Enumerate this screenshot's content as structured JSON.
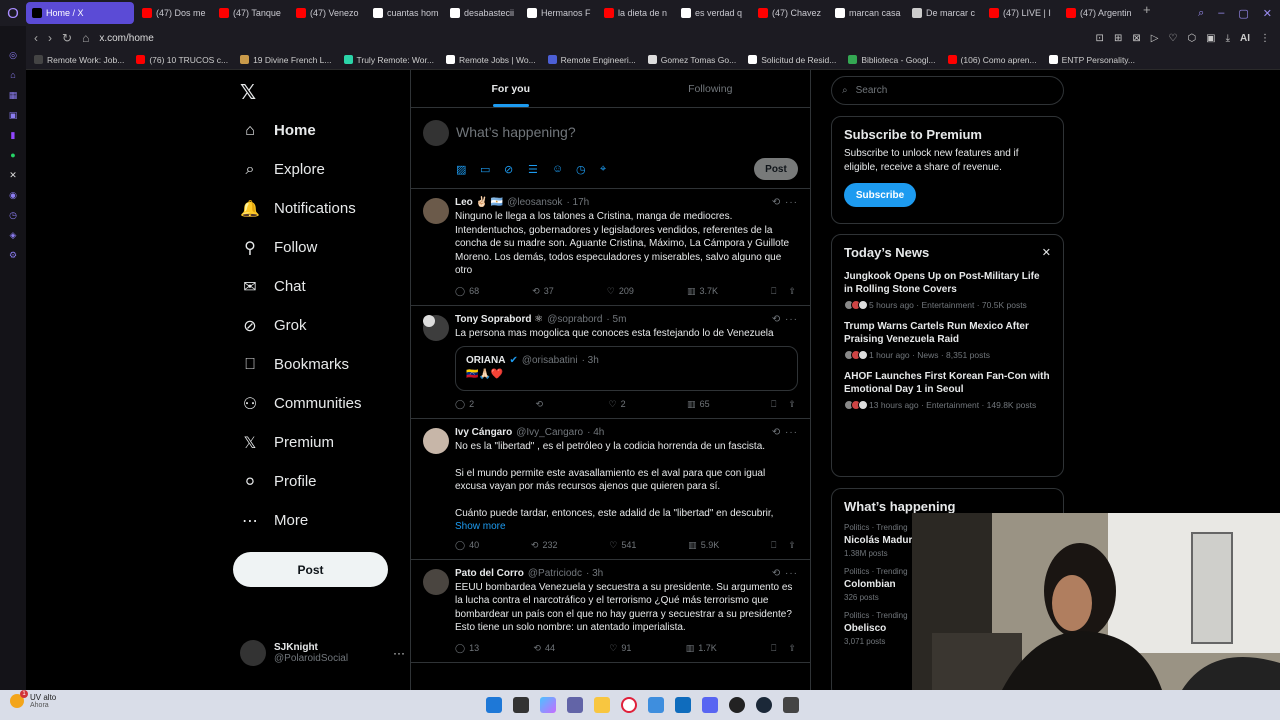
{
  "browser": {
    "tabs": [
      {
        "label": "Home / X",
        "active": true,
        "color": "#000000"
      },
      {
        "label": "(47) Dos me",
        "color": "#ff0000"
      },
      {
        "label": "(47) Tanque",
        "color": "#ff0000"
      },
      {
        "label": "(47) Venezo",
        "color": "#ff0000"
      },
      {
        "label": "cuantas hom",
        "color": "#ffffff"
      },
      {
        "label": "desabastecii",
        "color": "#ffffff"
      },
      {
        "label": "Hermanos F",
        "color": "#ffffff"
      },
      {
        "label": "la dieta de n",
        "color": "#ff0000"
      },
      {
        "label": "es verdad q",
        "color": "#ffffff"
      },
      {
        "label": "(47) Chavez",
        "color": "#ff0000"
      },
      {
        "label": "marcan casa",
        "color": "#ffffff"
      },
      {
        "label": "De marcar c",
        "color": "#cccccc"
      },
      {
        "label": "(47) LIVE | I",
        "color": "#ff0000"
      },
      {
        "label": "(47) Argentin",
        "color": "#ff0000"
      }
    ],
    "url": "x.com/home",
    "ai_label": "AI",
    "bookmarks": [
      {
        "label": "Remote Work: Job...",
        "color": "#444444"
      },
      {
        "label": "(76) 10 TRUCOS c...",
        "color": "#ff0000"
      },
      {
        "label": "19 Divine French L...",
        "color": "#c99a4a"
      },
      {
        "label": "Truly Remote: Wor...",
        "color": "#2bd4a8"
      },
      {
        "label": "Remote Jobs | Wo...",
        "color": "#ffffff"
      },
      {
        "label": "Remote Engineeri...",
        "color": "#4c5fd5"
      },
      {
        "label": "Gomez Tomas Go...",
        "color": "#dddddd"
      },
      {
        "label": "Solicitud de Resid...",
        "color": "#ffffff"
      },
      {
        "label": "Biblioteca - Googl...",
        "color": "#34a853"
      },
      {
        "label": "(106) Como apren...",
        "color": "#ff0000"
      },
      {
        "label": "ENTP Personality...",
        "color": "#ffffff"
      }
    ]
  },
  "nav": {
    "items": [
      {
        "label": "Home",
        "icon": "⌂"
      },
      {
        "label": "Explore",
        "icon": "⌕"
      },
      {
        "label": "Notifications",
        "icon": "🔔"
      },
      {
        "label": "Follow",
        "icon": "⚲"
      },
      {
        "label": "Chat",
        "icon": "✉"
      },
      {
        "label": "Grok",
        "icon": "⊘"
      },
      {
        "label": "Bookmarks",
        "icon": "⎕"
      },
      {
        "label": "Communities",
        "icon": "⚇"
      },
      {
        "label": "Premium",
        "icon": "𝕏"
      },
      {
        "label": "Profile",
        "icon": "⚪"
      },
      {
        "label": "More",
        "icon": "⋯"
      }
    ],
    "post_label": "Post",
    "account": {
      "name": "SJKnight",
      "handle": "@PolaroidSocial"
    }
  },
  "feed": {
    "tabs": [
      "For you",
      "Following"
    ],
    "compose_placeholder": "What’s happening?",
    "post_label": "Post",
    "tweets": [
      {
        "name": "Leo ✌🏻 🇦🇷",
        "handle": "@leosansok",
        "time": "· 17h",
        "text": "Ninguno le llega a los talones a Cristina, manga de mediocres. Intendentuchos, gobernadores y legisladores vendidos, referentes de la concha de su madre son. Aguante Cristina, Máximo, La Cámpora y Guillote Moreno. Los demás, todos especuladores y miserables, salvo alguno que otro",
        "replies": "68",
        "reposts": "37",
        "likes": "209",
        "views": "3.7K"
      },
      {
        "name": "Tony Soprabord ⚛",
        "handle": "@soprabord",
        "time": "· 5m",
        "text": "La persona mas mogolica que conoces esta festejando lo de Venezuela",
        "quote": {
          "name": "ORIANA",
          "handle": "@orisabatini",
          "time": "· 3h",
          "text": "🇻🇪🙏🏻❤️"
        },
        "replies": "2",
        "reposts": "",
        "likes": "2",
        "views": "65"
      },
      {
        "name": "Ivy Cángaro",
        "handle": "@Ivy_Cangaro",
        "time": "· 4h",
        "text": "No es la \"libertad\" , es el petróleo y la codicia horrenda de un fascista.\n\nSi el mundo permite este avasallamiento es el aval para que con igual excusa vayan por más recursos ajenos que quieren para sí.\n\nCuánto puede tardar, entonces, este adalid de la \"libertad\" en descubrir,",
        "show_more": "Show more",
        "replies": "40",
        "reposts": "232",
        "likes": "541",
        "views": "5.9K"
      },
      {
        "name": "Pato del Corro",
        "handle": "@Patriciodc",
        "time": "· 3h",
        "text": "EEUU bombardea Venezuela y secuestra a su presidente. Su argumento es la lucha contra el narcotráfico y el terrorismo ¿Qué más terrorismo que bombardear un país con el que no hay guerra y secuestrar a su presidente?  Esto tiene un solo nombre: un atentado imperialista.",
        "replies": "13",
        "reposts": "44",
        "likes": "91",
        "views": "1.7K"
      }
    ]
  },
  "right": {
    "search_placeholder": "Search",
    "premium": {
      "title": "Subscribe to Premium",
      "text": "Subscribe to unlock new features and if eligible, receive a share of revenue.",
      "button": "Subscribe"
    },
    "news": {
      "title": "Today’s News",
      "items": [
        {
          "title": "Jungkook Opens Up on Post-Military Life in Rolling Stone Covers",
          "meta": "5 hours ago · Entertainment · 70.5K posts"
        },
        {
          "title": "Trump Warns Cartels Run Mexico After Praising Venezuela Raid",
          "meta": "1 hour ago · News · 8,351 posts"
        },
        {
          "title": "AHOF Launches First Korean Fan-Con with Emotional Day 1 in Seoul",
          "meta": "13 hours ago · Entertainment · 149.8K posts"
        }
      ]
    },
    "happening": {
      "title": "What’s happening",
      "trends": [
        {
          "meta": "Politics · Trending",
          "name": "Nicolás Madur",
          "posts": "1.38M posts"
        },
        {
          "meta": "Politics · Trending",
          "name": "Colombian",
          "posts": "326 posts"
        },
        {
          "meta": "Politics · Trending",
          "name": "Obelisco",
          "posts": "3,071 posts"
        }
      ]
    }
  },
  "taskbar": {
    "weather": "UV alto",
    "weather_sub": "Ahora",
    "badge": "1"
  }
}
